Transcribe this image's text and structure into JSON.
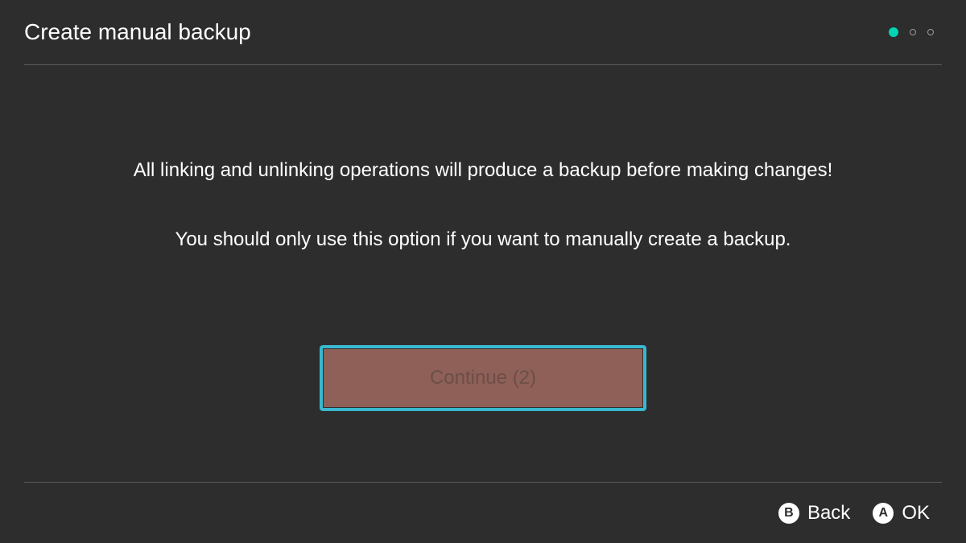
{
  "header": {
    "title": "Create manual backup",
    "progress": {
      "current_step": 1,
      "total_steps": 3
    }
  },
  "content": {
    "message_line1": "All linking and unlinking operations will produce a backup before making changes!",
    "message_line2": "You should only use this option if you want to manually create a backup.",
    "continue_button_label": "Continue (2)"
  },
  "footer": {
    "hints": {
      "back": {
        "icon": "B",
        "label": "Back"
      },
      "ok": {
        "icon": "A",
        "label": "OK"
      }
    }
  },
  "colors": {
    "accent": "#00d4b5",
    "focus_ring": "#39b8cf",
    "button_bg": "#8f6057"
  }
}
